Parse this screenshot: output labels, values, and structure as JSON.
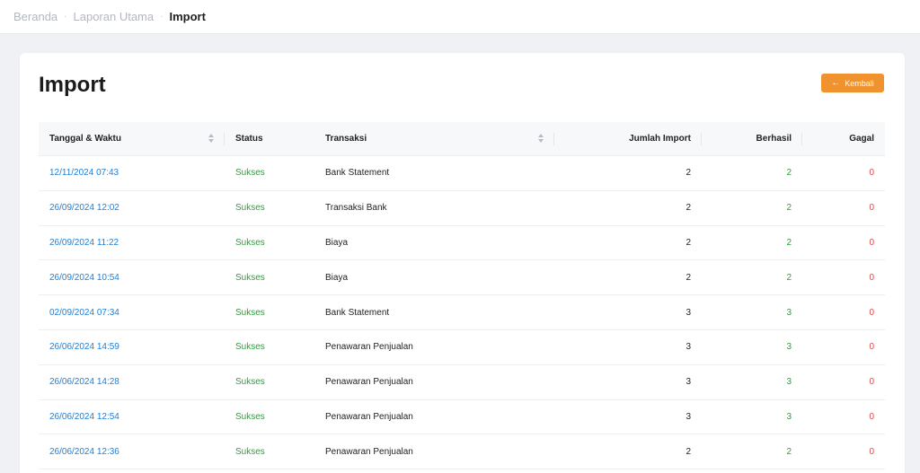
{
  "breadcrumb": {
    "items": [
      "Beranda",
      "Laporan Utama",
      "Import"
    ]
  },
  "page": {
    "title": "Import",
    "back_label": "Kembali"
  },
  "colors": {
    "accent": "#f0922e",
    "link": "#1e7fd8",
    "success": "#2e9d3c",
    "failure": "#e04848"
  },
  "table": {
    "headers": {
      "datetime": "Tanggal & Waktu",
      "status": "Status",
      "transaction": "Transaksi",
      "imported": "Jumlah Import",
      "success": "Berhasil",
      "failed": "Gagal"
    },
    "rows": [
      {
        "datetime": "12/11/2024 07:43",
        "status": "Sukses",
        "transaction": "Bank Statement",
        "imported": "2",
        "success": "2",
        "failed": "0"
      },
      {
        "datetime": "26/09/2024 12:02",
        "status": "Sukses",
        "transaction": "Transaksi Bank",
        "imported": "2",
        "success": "2",
        "failed": "0"
      },
      {
        "datetime": "26/09/2024 11:22",
        "status": "Sukses",
        "transaction": "Biaya",
        "imported": "2",
        "success": "2",
        "failed": "0"
      },
      {
        "datetime": "26/09/2024 10:54",
        "status": "Sukses",
        "transaction": "Biaya",
        "imported": "2",
        "success": "2",
        "failed": "0"
      },
      {
        "datetime": "02/09/2024 07:34",
        "status": "Sukses",
        "transaction": "Bank Statement",
        "imported": "3",
        "success": "3",
        "failed": "0"
      },
      {
        "datetime": "26/06/2024 14:59",
        "status": "Sukses",
        "transaction": "Penawaran Penjualan",
        "imported": "3",
        "success": "3",
        "failed": "0"
      },
      {
        "datetime": "26/06/2024 14:28",
        "status": "Sukses",
        "transaction": "Penawaran Penjualan",
        "imported": "3",
        "success": "3",
        "failed": "0"
      },
      {
        "datetime": "26/06/2024 12:54",
        "status": "Sukses",
        "transaction": "Penawaran Penjualan",
        "imported": "3",
        "success": "3",
        "failed": "0"
      },
      {
        "datetime": "26/06/2024 12:36",
        "status": "Sukses",
        "transaction": "Penawaran Penjualan",
        "imported": "2",
        "success": "2",
        "failed": "0"
      }
    ]
  }
}
